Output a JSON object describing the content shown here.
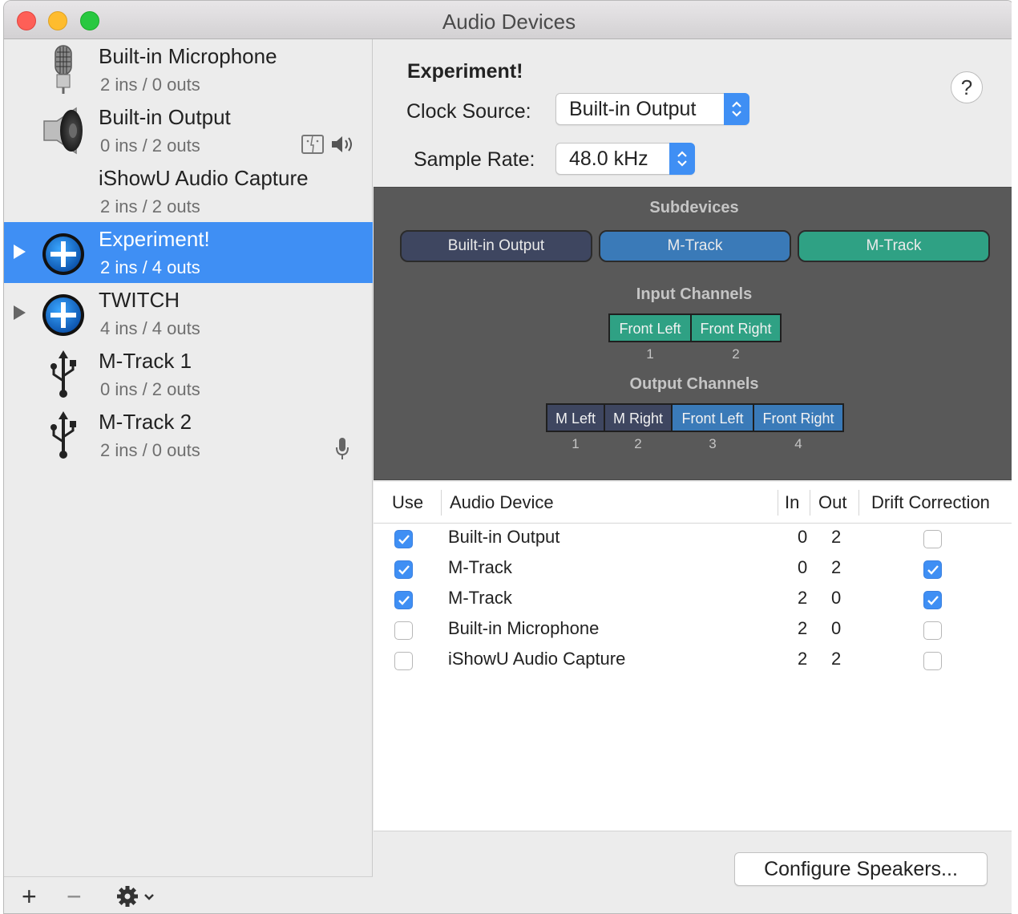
{
  "window": {
    "title": "Audio Devices"
  },
  "sidebar": {
    "devices": [
      {
        "name": "Built-in Microphone",
        "io": "2 ins / 0 outs",
        "icon": "microphone-icon"
      },
      {
        "name": "Built-in Output",
        "io": "0 ins / 2 outs",
        "icon": "speaker-icon"
      },
      {
        "name": "iShowU Audio Capture",
        "io": "2 ins / 2 outs",
        "icon": ""
      },
      {
        "name": "Experiment!",
        "io": "2 ins / 4 outs",
        "icon": "aggregate-device-icon",
        "selected": true
      },
      {
        "name": "TWITCH",
        "io": "4 ins / 4 outs",
        "icon": "aggregate-device-icon"
      },
      {
        "name": "M-Track 1",
        "io": "0 ins / 2 outs",
        "icon": "usb-icon"
      },
      {
        "name": "M-Track 2",
        "io": "2 ins / 0 outs",
        "icon": "usb-icon"
      }
    ],
    "add_label": "+",
    "remove_label": "−"
  },
  "detail": {
    "heading": "Experiment!",
    "clock_source_label": "Clock Source:",
    "clock_source_value": "Built-in Output",
    "sample_rate_label": "Sample Rate:",
    "sample_rate_value": "48.0 kHz",
    "help_label": "?"
  },
  "subdevices": {
    "title": "Subdevices",
    "items": [
      {
        "label": "Built-in Output",
        "color": "#3e4660"
      },
      {
        "label": "M-Track",
        "color": "#3a7ab8"
      },
      {
        "label": "M-Track",
        "color": "#2fa184"
      }
    ],
    "input_title": "Input Channels",
    "input_channels": [
      {
        "label": "Front Left",
        "num": "1",
        "color": "#2fa184"
      },
      {
        "label": "Front Right",
        "num": "2",
        "color": "#2fa184"
      }
    ],
    "output_title": "Output Channels",
    "output_channels": [
      {
        "label": "M Left",
        "num": "1",
        "color": "#3e4660"
      },
      {
        "label": "M Right",
        "num": "2",
        "color": "#3e4660"
      },
      {
        "label": "Front Left",
        "num": "3",
        "color": "#3a7ab8"
      },
      {
        "label": "Front Right",
        "num": "4",
        "color": "#3a7ab8"
      }
    ]
  },
  "table": {
    "headers": {
      "use": "Use",
      "device": "Audio Device",
      "in": "In",
      "out": "Out",
      "drift": "Drift Correction"
    },
    "rows": [
      {
        "use": true,
        "device": "Built-in Output",
        "in": "0",
        "out": "2",
        "drift": false
      },
      {
        "use": true,
        "device": "M-Track",
        "in": "0",
        "out": "2",
        "drift": true
      },
      {
        "use": true,
        "device": "M-Track",
        "in": "2",
        "out": "0",
        "drift": true
      },
      {
        "use": false,
        "device": "Built-in Microphone",
        "in": "2",
        "out": "0",
        "drift": false
      },
      {
        "use": false,
        "device": "iShowU Audio Capture",
        "in": "2",
        "out": "2",
        "drift": false
      }
    ]
  },
  "configure_label": "Configure Speakers..."
}
